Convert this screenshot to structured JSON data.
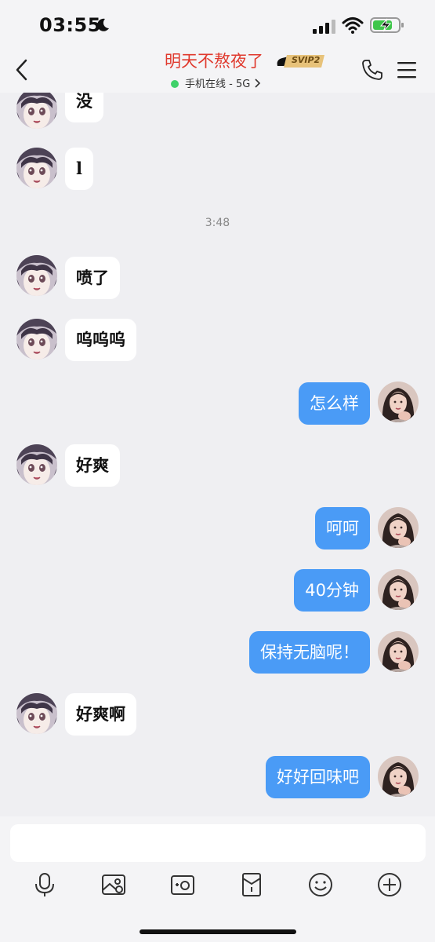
{
  "status_bar": {
    "time": "03:55"
  },
  "header": {
    "title": "明天不熬夜了",
    "badge": "SVIP2",
    "status": "手机在线 - 5G"
  },
  "messages": [
    {
      "side": "left",
      "text": "没"
    },
    {
      "side": "left",
      "text": "l"
    },
    {
      "type": "time",
      "text": "3:48"
    },
    {
      "side": "left",
      "text": "喷了"
    },
    {
      "side": "left",
      "text": "呜呜呜"
    },
    {
      "side": "right",
      "text": "怎么样"
    },
    {
      "side": "left",
      "text": "好爽"
    },
    {
      "side": "right",
      "text": "呵呵"
    },
    {
      "side": "right",
      "text": "40分钟"
    },
    {
      "side": "right",
      "text": "保持无脑呢！"
    },
    {
      "side": "left",
      "text": "好爽啊"
    },
    {
      "side": "right",
      "text": "好好回味吧"
    }
  ],
  "input": {
    "value": "",
    "placeholder": ""
  },
  "toolbar": {
    "icons": [
      "microphone-icon",
      "image-icon",
      "camera-icon",
      "red-packet-icon",
      "emoji-icon",
      "plus-icon"
    ]
  },
  "colors": {
    "accent": "#4a9bf6",
    "title": "#e0392d",
    "online": "#3fd16a"
  }
}
